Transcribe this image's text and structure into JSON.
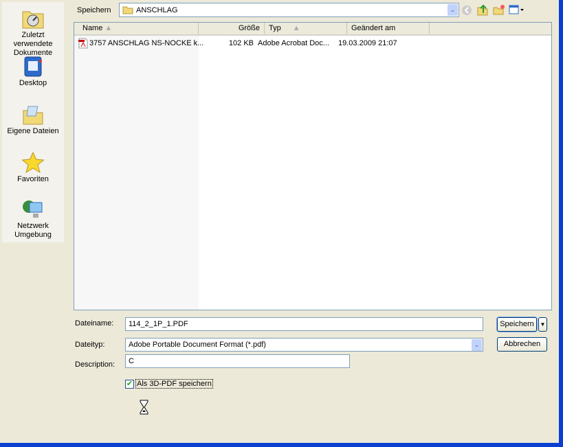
{
  "sidebar": {
    "items": [
      {
        "label": "Zuletzt verwendete Dokumente",
        "icon": "recent-documents-icon"
      },
      {
        "label": "Desktop",
        "icon": "desktop-icon"
      },
      {
        "label": "Eigene Dateien",
        "icon": "my-documents-icon"
      },
      {
        "label": "Favoriten",
        "icon": "favorites-star-icon"
      },
      {
        "label": "Netzwerk Umgebung",
        "icon": "network-icon"
      }
    ]
  },
  "toolbar": {
    "save_in_label": "Speichern",
    "folder": "ANSCHLAG"
  },
  "list": {
    "columns": [
      "Name",
      "Größe",
      "Typ",
      "Geändert am"
    ],
    "rows": [
      {
        "name": "3757 ANSCHLAG NS-NOCKE k...",
        "size": "102 KB",
        "type": "Adobe Acrobat Doc...",
        "modified": "19.03.2009 21:07"
      }
    ]
  },
  "form": {
    "filename_label": "Dateiname:",
    "filename": "114_2_1P_1.PDF",
    "filetype_label": "Dateityp:",
    "filetype": "Adobe Portable Document Format (*.pdf)",
    "description_label": "Description:",
    "description": "C",
    "checkbox_label": "Als 3D-PDF speichern",
    "checkbox_checked": true,
    "save_button": "Speichern",
    "cancel_button": "Abbrechen"
  }
}
